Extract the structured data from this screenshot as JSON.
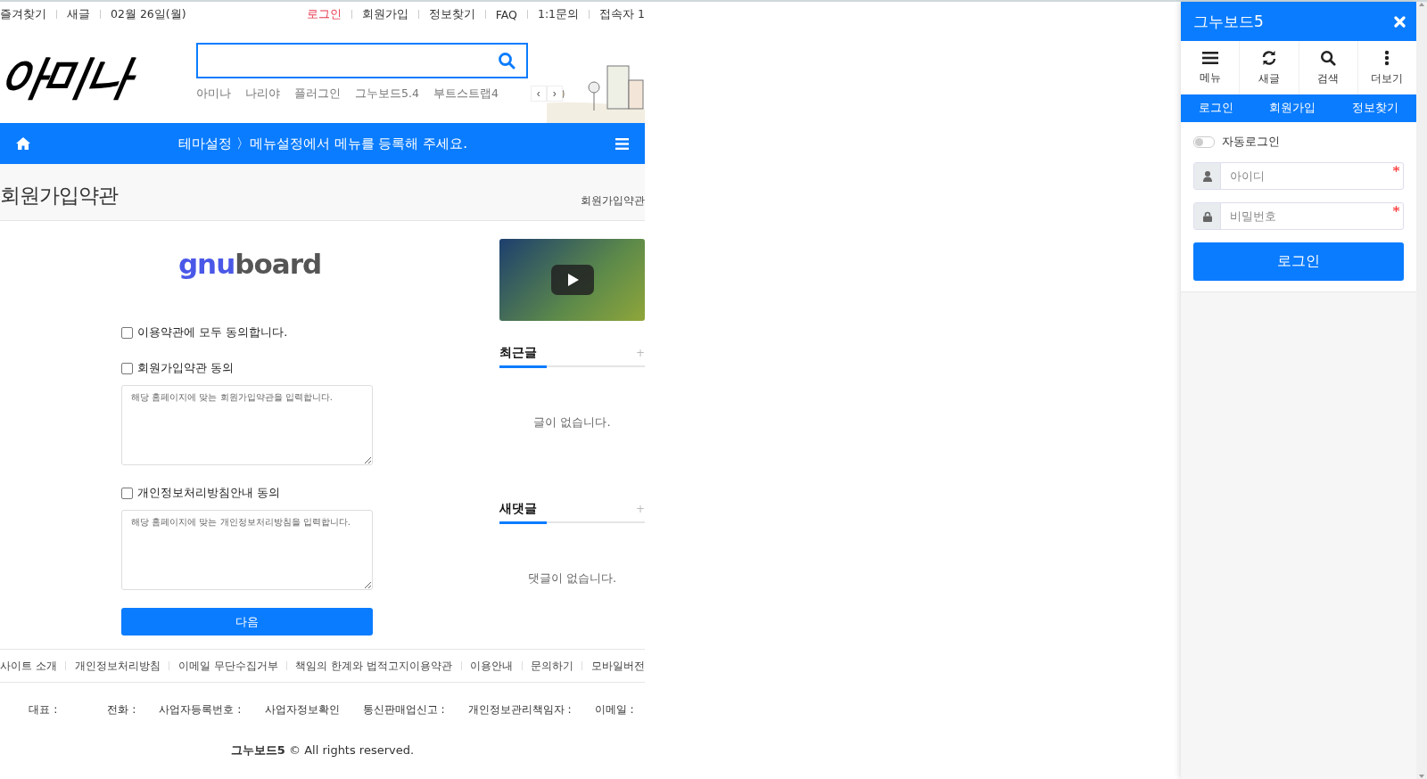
{
  "top_bar": {
    "left_links": [
      "즐겨찾기",
      "새글"
    ],
    "date": "02월 26일(월)",
    "right_links": [
      {
        "label": "로그인",
        "highlight": true
      },
      {
        "label": "회원가입",
        "highlight": false
      },
      {
        "label": "정보찾기",
        "highlight": false
      },
      {
        "label": "FAQ",
        "highlight": false
      },
      {
        "label": "1:1문의",
        "highlight": false
      },
      {
        "label": "접속자 1",
        "highlight": false
      }
    ]
  },
  "header": {
    "logo": "아미나",
    "keywords": [
      "아미나",
      "나리야",
      "플러그인",
      "그누보드5.4",
      "부트스트랩4"
    ],
    "prev": "‹",
    "next": "›"
  },
  "main_menu": {
    "notice": "테마설정 〉메뉴설정에서 메뉴를 등록해 주세요."
  },
  "page": {
    "title": "회원가입약관",
    "breadcrumb": "회원가입약관"
  },
  "register": {
    "brand": {
      "prefix": "gnu",
      "suffix": "board"
    },
    "agreements": [
      {
        "label": "이용약관에 모두 동의합니다.",
        "checked": false
      },
      {
        "label": "회원가입약관 동의",
        "checked": false,
        "text": "해당 홈페이지에 맞는 회원가입약관을 입력합니다."
      },
      {
        "label": "개인정보처리방침안내 동의",
        "checked": false,
        "text": "해당 홈페이지에 맞는 개인정보처리방침을 입력합니다."
      }
    ],
    "next_button": "다음"
  },
  "sidebar": {
    "widgets": [
      {
        "title": "최근글",
        "more": "+",
        "empty": "글이 없습니다."
      },
      {
        "title": "새댓글",
        "more": "+",
        "empty": "댓글이 없습니다."
      }
    ]
  },
  "footer": {
    "links": [
      "사이트 소개",
      "개인정보처리방침",
      "이메일 무단수집거부",
      "책임의 한계와 법적고지이용약관",
      "이용안내",
      "문의하기",
      "모바일버전"
    ],
    "info": [
      "대표 :",
      "전화 :",
      "사업자등록번호 :",
      "사업자정보확인",
      "통신판매업신고 :",
      "개인정보관리책임자 :",
      "이메일 :"
    ],
    "copyright": "**그누보드5** © All rights reserved."
  },
  "panel": {
    "title": "그누보드5",
    "actions": [
      {
        "kind": "menu",
        "label": "메뉴"
      },
      {
        "kind": "refresh",
        "label": "새글"
      },
      {
        "kind": "search",
        "label": "검색"
      },
      {
        "kind": "more",
        "label": "더보기"
      }
    ],
    "tabs": [
      "로그인",
      "회원가입",
      "정보찾기"
    ],
    "auto_login": {
      "label": "자동로그인",
      "on": false
    },
    "fields": [
      {
        "kind": "user",
        "placeholder": "아이디",
        "required": true
      },
      {
        "kind": "lock",
        "placeholder": "비밀번호",
        "required": true
      }
    ],
    "login_button": "로그인"
  }
}
